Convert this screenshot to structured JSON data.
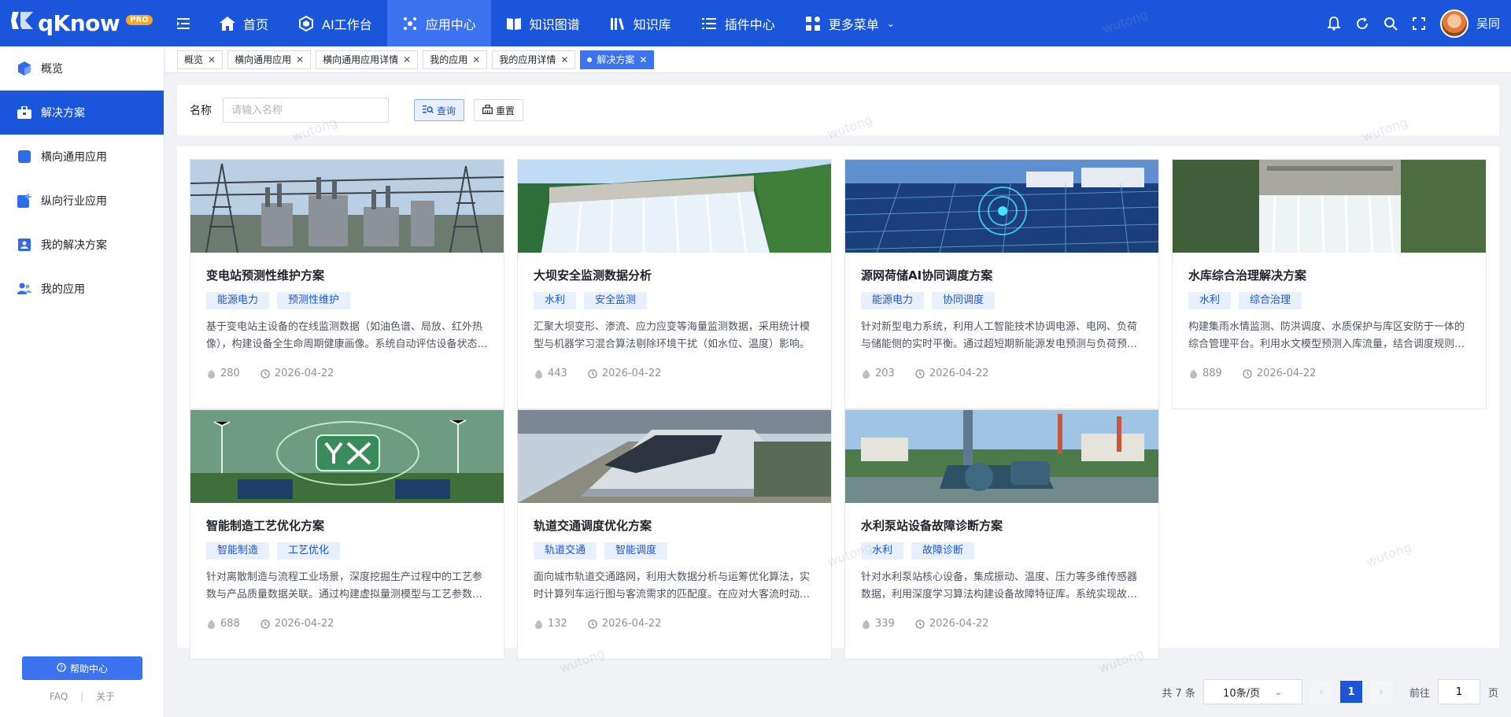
{
  "brand": {
    "name": "qKnow",
    "badge": "PRO"
  },
  "nav": [
    {
      "label": "首页",
      "icon": "home-icon",
      "active": false
    },
    {
      "label": "AI工作台",
      "icon": "cube-icon",
      "active": false
    },
    {
      "label": "应用中心",
      "icon": "apps-icon",
      "active": true
    },
    {
      "label": "知识图谱",
      "icon": "book-icon",
      "active": false
    },
    {
      "label": "知识库",
      "icon": "library-icon",
      "active": false
    },
    {
      "label": "插件中心",
      "icon": "list-icon",
      "active": false
    },
    {
      "label": "更多菜单",
      "icon": "grid-icon",
      "active": false
    }
  ],
  "user": {
    "name": "吴同"
  },
  "sidebar": {
    "items": [
      {
        "label": "概览",
        "icon": "cube-icon",
        "active": false
      },
      {
        "label": "解决方案",
        "icon": "briefcase-icon",
        "active": true
      },
      {
        "label": "横向通用应用",
        "icon": "app-icon",
        "active": false
      },
      {
        "label": "纵向行业应用",
        "icon": "app-add-icon",
        "active": false
      },
      {
        "label": "我的解决方案",
        "icon": "user-card-icon",
        "active": false
      },
      {
        "label": "我的应用",
        "icon": "user-group-icon",
        "active": false
      }
    ],
    "help_label": "帮助中心",
    "footer": {
      "faq": "FAQ",
      "sep": "|",
      "about": "关于"
    }
  },
  "tabs": [
    {
      "label": "概览",
      "active": false
    },
    {
      "label": "横向通用应用",
      "active": false
    },
    {
      "label": "横向通用应用详情",
      "active": false
    },
    {
      "label": "我的应用",
      "active": false
    },
    {
      "label": "我的应用详情",
      "active": false
    },
    {
      "label": "解决方案",
      "active": true
    }
  ],
  "search": {
    "label": "名称",
    "placeholder": "请输入名称",
    "value": "",
    "query_label": "查询",
    "reset_label": "重置"
  },
  "cards": [
    {
      "title": "变电站预测性维护方案",
      "tags": [
        "能源电力",
        "预测性维护"
      ],
      "desc": "基于变电站主设备的在线监测数据（如油色谱、局放、红外热像），构建设备全生命周期健康画像。系统自动评估设备状态并给出维护建议。",
      "views": "280",
      "date": "2026-04-22",
      "img": "substation"
    },
    {
      "title": "大坝安全监测数据分析",
      "tags": [
        "水利",
        "安全监测"
      ],
      "desc": "汇聚大坝变形、渗流、应力应变等海量监测数据，采用统计模型与机器学习混合算法剔除环境干扰（如水位、温度）影响。",
      "views": "443",
      "date": "2026-04-22",
      "img": "dam"
    },
    {
      "title": "源网荷储AI协同调度方案",
      "tags": [
        "能源电力",
        "协同调度"
      ],
      "desc": "针对新型电力系统，利用人工智能技术协调电源、电网、负荷与储能侧的实时平衡。通过超短期新能源发电预测与负荷预测优化调度。",
      "views": "203",
      "date": "2026-04-22",
      "img": "solar"
    },
    {
      "title": "水库综合治理解决方案",
      "tags": [
        "水利",
        "综合治理"
      ],
      "desc": "构建集雨水情监测、防洪调度、水质保护与库区安防于一体的综合管理平台。利用水文模型预测入库流量，结合调度规则优化水库运行。",
      "views": "889",
      "date": "2026-04-22",
      "img": "reservoir"
    },
    {
      "title": "智能制造工艺优化方案",
      "tags": [
        "智能制造",
        "工艺优化"
      ],
      "desc": "针对离散制造与流程工业场景，深度挖掘生产过程中的工艺参数与产品质量数据关联。通过构建虚拟量测模型与工艺参数推荐引擎提升良率。",
      "views": "688",
      "date": "2026-04-22",
      "img": "ai"
    },
    {
      "title": "轨道交通调度优化方案",
      "tags": [
        "轨道交通",
        "智能调度"
      ],
      "desc": "面向城市轨道交通路网，利用大数据分析与运筹优化算法，实时计算列车运行图与客流需求的匹配度。在应对大客流时动态调整行车方案。",
      "views": "132",
      "date": "2026-04-22",
      "img": "train"
    },
    {
      "title": "水利泵站设备故障诊断方案",
      "tags": [
        "水利",
        "故障诊断"
      ],
      "desc": "针对水利泵站核心设备，集成振动、温度、压力等多维传感器数据，利用深度学习算法构建设备故障特征库。系统实现故障早期预警。",
      "views": "339",
      "date": "2026-04-22",
      "img": "pump"
    }
  ],
  "pagination": {
    "total_text": "共 7 条",
    "page_size": "10条/页",
    "current": "1",
    "goto_label": "前往",
    "goto_value": "1",
    "page_unit": "页"
  },
  "watermark": "wutong",
  "colors": {
    "primary": "#1a56db",
    "accent": "#3b73f0",
    "tag_bg": "#e8f0fe"
  }
}
